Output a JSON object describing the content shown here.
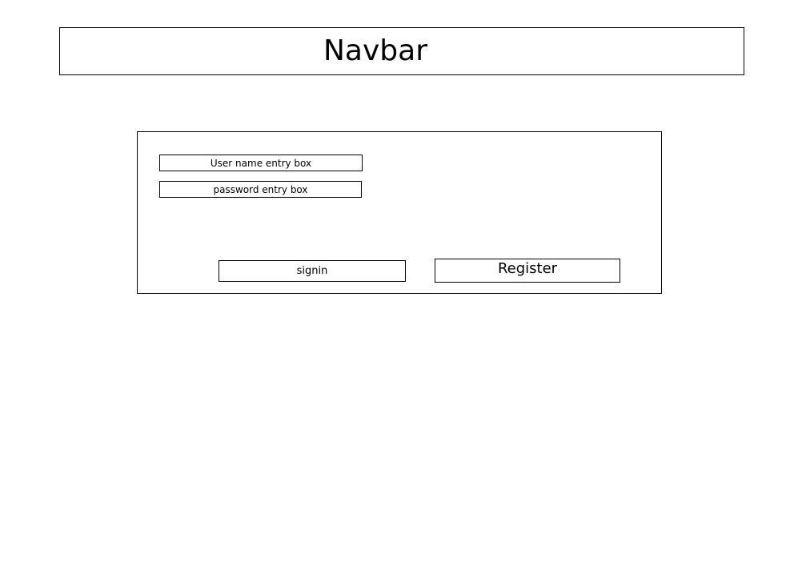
{
  "navbar": {
    "title": "Navbar"
  },
  "login": {
    "username_placeholder": "User name entry box",
    "password_placeholder": "password entry box",
    "signin_label": "signin",
    "register_label": "Register"
  }
}
